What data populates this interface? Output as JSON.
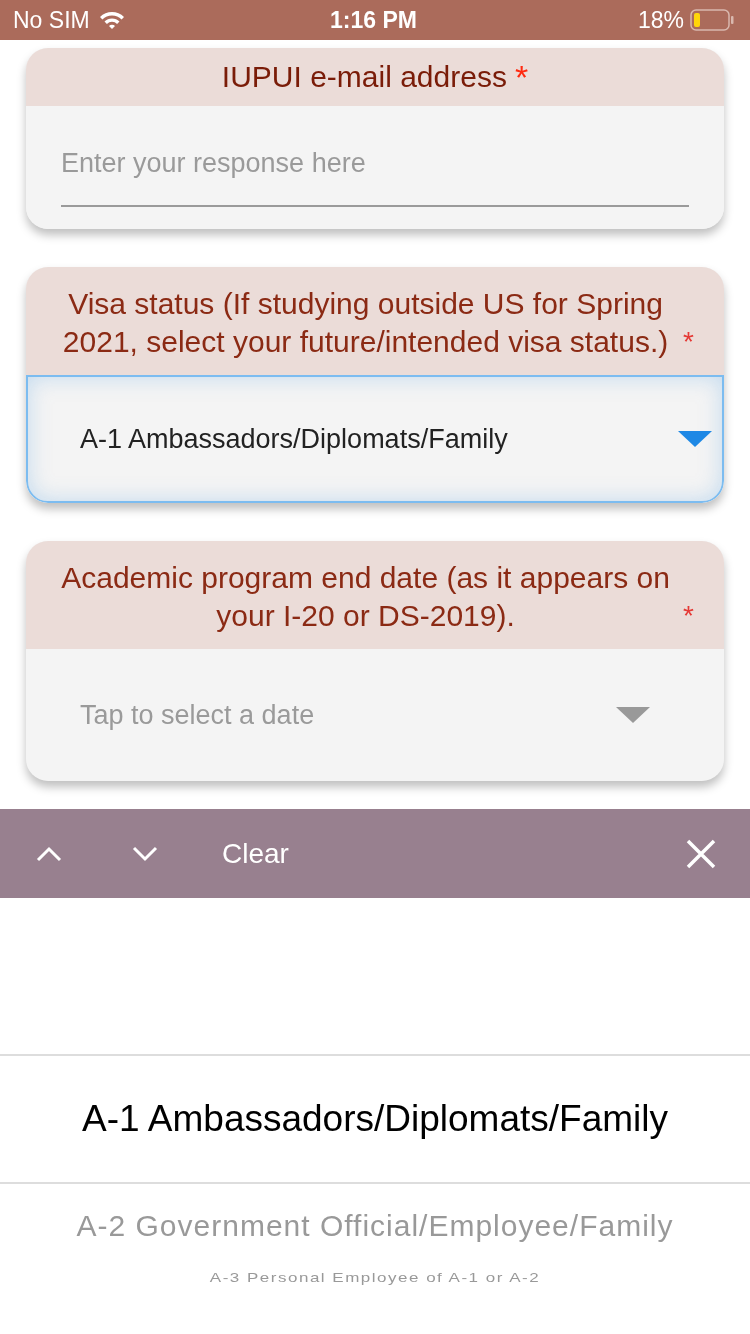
{
  "status_bar": {
    "carrier": "No SIM",
    "time": "1:16 PM",
    "battery": "18%"
  },
  "questions": [
    {
      "kind": "text",
      "title": "IUPUI e-mail address",
      "required_mark": "*",
      "placeholder": "Enter your response here"
    },
    {
      "kind": "select",
      "title": "Visa status (If studying outside US for Spring 2021, select your future/intended visa status.)",
      "required_mark": "*",
      "value": "A-1 Ambassadors/Diplomats/Family",
      "focused": true
    },
    {
      "kind": "date",
      "title": "Academic program end date (as it appears on your I-20 or DS-2019).",
      "required_mark": "*",
      "placeholder": "Tap to select a date",
      "focused": false
    }
  ],
  "toolbar": {
    "clear": "Clear"
  },
  "picker": [
    {
      "label": "A-1 Ambassadors/Diplomats/Family",
      "selected": true
    },
    {
      "label": "A-2 Government Official/Employee/Family",
      "selected": false
    },
    {
      "label": "A-3 Personal Employee of A-1 or A-2",
      "selected": false
    }
  ]
}
